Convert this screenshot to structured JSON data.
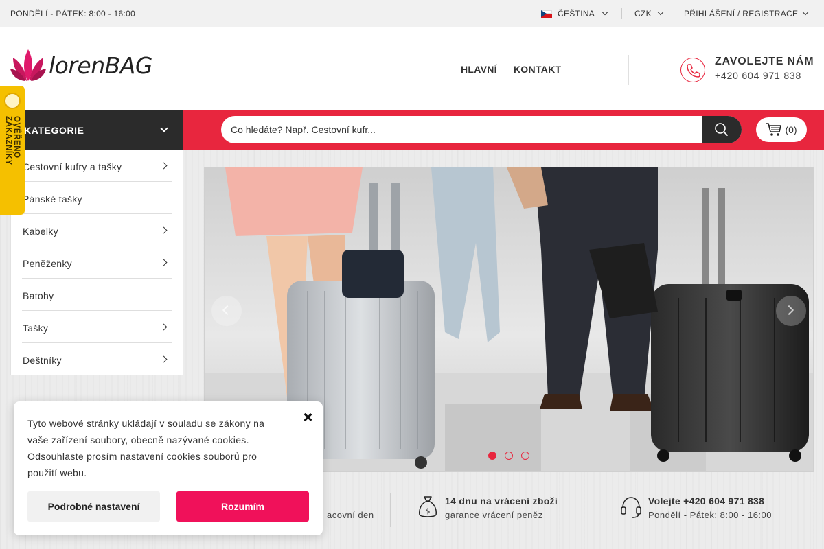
{
  "topbar": {
    "hours": "PONDĚLÍ - PÁTEK: 8:00 - 16:00",
    "language": "ČEŠTINA",
    "currency": "CZK",
    "login": "PŘIHLÁŠENÍ / REGISTRACE"
  },
  "header": {
    "logo_text": "lorenBAG",
    "nav": [
      "HLAVNÍ",
      "KONTAKT"
    ],
    "call_title": "ZAVOLEJTE NÁM",
    "call_number": "+420 604 971 838"
  },
  "categories": {
    "heading": "KATEGORIE",
    "items": [
      {
        "label": "Cestovní kufry a tašky",
        "has_submenu": true
      },
      {
        "label": "Pánské tašky",
        "has_submenu": false
      },
      {
        "label": "Kabelky",
        "has_submenu": true
      },
      {
        "label": "Peněženky",
        "has_submenu": true
      },
      {
        "label": "Batohy",
        "has_submenu": false
      },
      {
        "label": "Tašky",
        "has_submenu": true
      },
      {
        "label": "Deštníky",
        "has_submenu": true
      }
    ]
  },
  "search": {
    "placeholder": "Co hledáte? Např. Cestovní kufr..."
  },
  "cart": {
    "count_label": "(0)"
  },
  "badge": {
    "text": "OVĚŘENO ZÁKAZNÍKY"
  },
  "slider": {
    "active_slide": 1,
    "slide_count": 3
  },
  "benefits": [
    {
      "title": "",
      "subtitle": "acovní den"
    },
    {
      "title": "14 dnu na vrácení zboží",
      "subtitle": "garance vrácení peněz"
    },
    {
      "title": "Volejte +420 604 971 838",
      "subtitle": "Pondělí - Pátek: 8:00 - 16:00"
    }
  ],
  "cookie": {
    "text": "Tyto webové stránky ukládají v souladu se zákony na vaše zařízení soubory, obecně nazývané cookies. Odsouhlaste prosím nastavení cookies souborů pro použití webu.",
    "detail_button": "Podrobné nastavení",
    "accept_button": "Rozumím"
  },
  "colors": {
    "accent_red": "#e8263e",
    "accept_pink": "#f0115a",
    "dark": "#2b2b2b",
    "badge_yellow": "#f5c000"
  },
  "icons": [
    "chevron-down-icon",
    "czech-flag-icon",
    "phone-icon",
    "search-icon",
    "cart-icon",
    "chevron-right-icon",
    "money-bag-icon",
    "headset-icon",
    "close-icon"
  ]
}
